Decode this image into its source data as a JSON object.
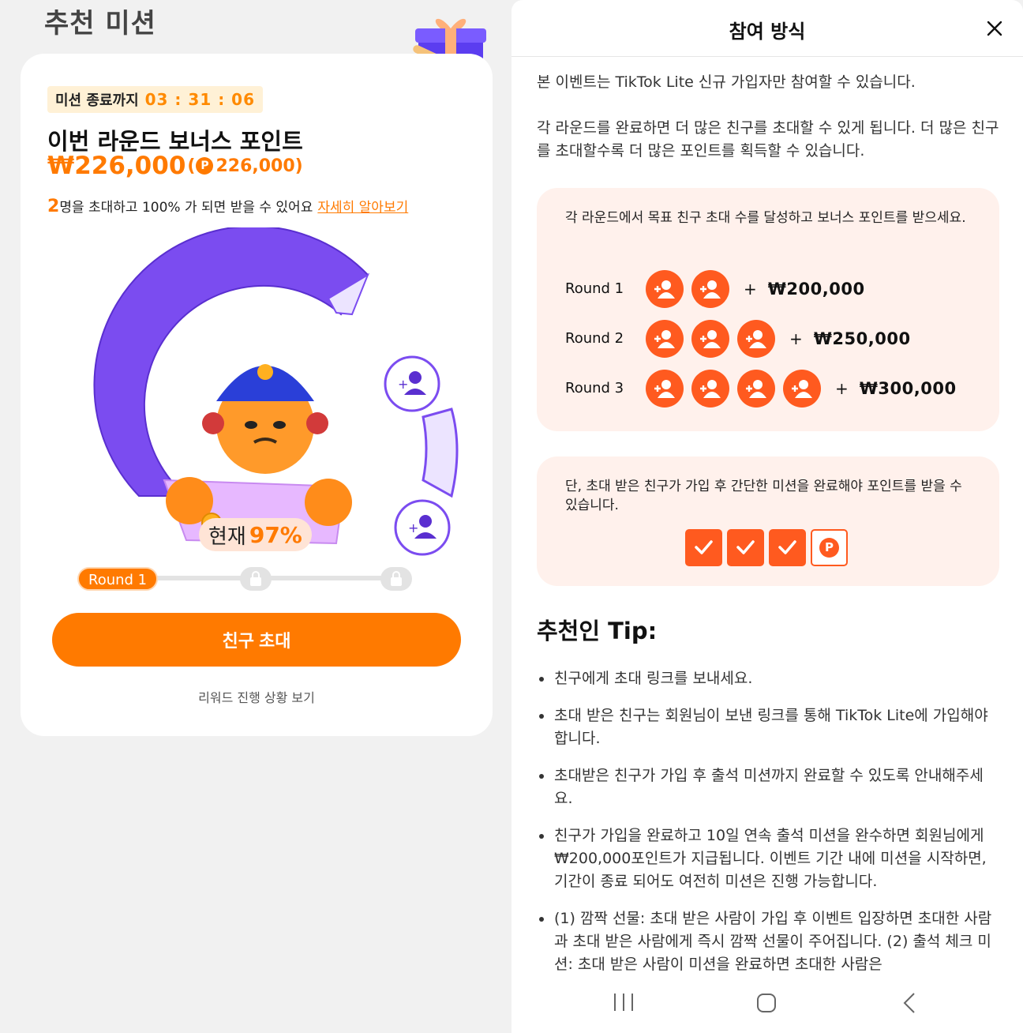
{
  "left": {
    "title": "추천 미션",
    "timer_label": "미션 종료까지",
    "timer_value": "03 : 31 : 06",
    "round_title": "이번 라운드 보너스 포인트",
    "bonus_amount": "₩226,000",
    "bonus_points_open": "(",
    "bonus_points_coin": "P",
    "bonus_points_value": "226,000)",
    "invite_count": "2",
    "invite_text": "명을 초대하고 100% 가 되면 받을 수 있어요",
    "invite_link": "자세히 알아보기",
    "progress_label": "현재",
    "progress_value": "97%",
    "progress_fraction": 0.97,
    "track_round": "Round 1",
    "cta_label": "친구 초대",
    "reward_link": "리워드 진행 상황 보기"
  },
  "right": {
    "title": "참여 방식",
    "intro1": "본 이벤트는 TikTok Lite 신규 가입자만 참여할 수 있습니다.",
    "intro2": "각 라운드를 완료하면 더 많은 친구를 초대할 수 있게 됩니다. 더 많은 친구를 초대할수록 더 많은 포인트를 획득할 수 있습니다.",
    "box1_text": "각 라운드에서 목표 친구 초대 수를 달성하고 보너스 포인트를 받으세요.",
    "rounds": [
      {
        "name": "Round 1",
        "friends": 2,
        "plus": "+",
        "amount": "₩200,000"
      },
      {
        "name": "Round 2",
        "friends": 3,
        "plus": "+",
        "amount": "₩250,000"
      },
      {
        "name": "Round 3",
        "friends": 4,
        "plus": "+",
        "amount": "₩300,000"
      }
    ],
    "box2_text": "단, 초대 받은 친구가 가입 후 간단한 미션을 완료해야 포인트를 받을 수 있습니다.",
    "coin_label": "P",
    "tip_title": "추천인 Tip:",
    "tips": [
      "친구에게 초대 링크를 보내세요.",
      "초대 받은 친구는 회원님이 보낸 링크를 통해 TikTok Lite에 가입해야 합니다.",
      "초대받은 친구가 가입 후 출석 미션까지 완료할 수 있도록 안내해주세요.",
      "친구가 가입을 완료하고 10일 연속 출석 미션을 완수하면 회원님에게 ₩200,000포인트가 지급됩니다. 이벤트 기간 내에 미션을 시작하면, 기간이 종료 되어도 여전히 미션은 진행 가능합니다.",
      "(1) 깜짝 선물: 초대 받은 사람이 가입 후 이벤트 입장하면 초대한 사람과 초대 받은 사람에게 즉시 깜짝 선물이 주어집니다. (2) 출석 체크 미션: 초대 받은 사람이 미션을 완료하면 초대한 사람은"
    ]
  },
  "colors": {
    "accent": "#ff7a00",
    "purple": "#7b4cf0",
    "box_bg": "#fff1ec"
  },
  "icons": [
    "gift-icon",
    "add-friend-icon",
    "lock-icon",
    "close-icon",
    "check-icon",
    "coin-icon",
    "nav-recent-icon",
    "nav-home-icon",
    "nav-back-icon"
  ]
}
